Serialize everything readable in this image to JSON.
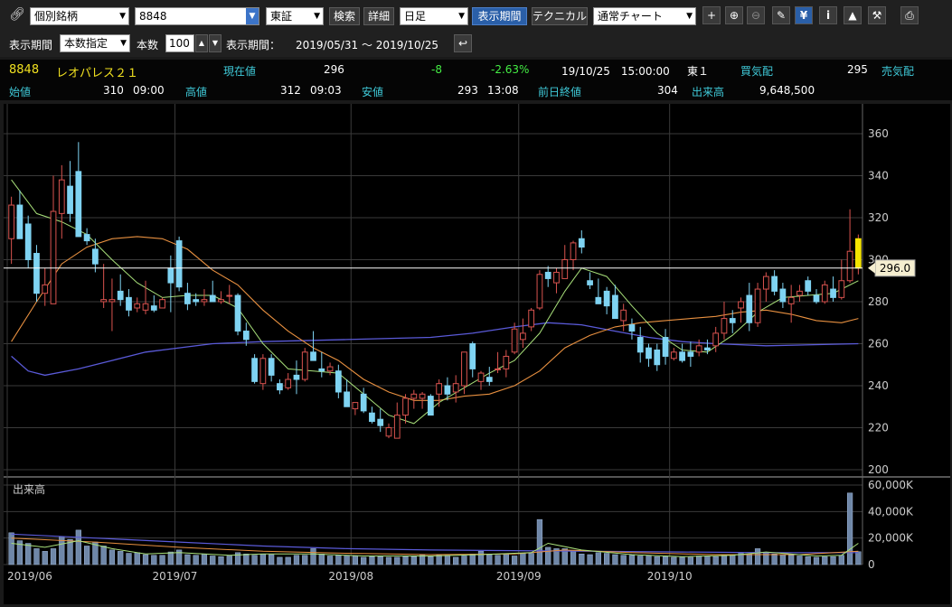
{
  "toolbar": {
    "mode_select": "個別銘柄",
    "code_input": "8848",
    "market_select": "東証",
    "search_label": "検索",
    "detail_label": "詳細",
    "period_select": "日足",
    "display_period_label": "表示期間",
    "technical_label": "テクニカル",
    "chart_type_select": "通常チャート"
  },
  "range_bar": {
    "period_label": "表示期間",
    "period_mode": "本数指定",
    "count_label": "本数",
    "count_value": "100",
    "range_label": "表示期間：",
    "range_value": "2019/05/31 ～ 2019/10/25"
  },
  "quote": {
    "code": "8848",
    "name": "レオパレス２１",
    "current_label": "現在値",
    "current": "296",
    "change": "-8",
    "change_pct": "-2.63%",
    "datetime": "19/10/25　15:00:00",
    "market": "東１",
    "bid_label": "買気配",
    "bid": "295",
    "ask_label": "売気配",
    "open_label": "始値",
    "open": "310",
    "open_time": "09:00",
    "high_label": "高値",
    "high": "312",
    "high_time": "09:03",
    "low_label": "安値",
    "low": "293",
    "low_time": "13:08",
    "prev_label": "前日終値",
    "prev": "304",
    "volume_label": "出来高",
    "volume": "9,648,500"
  },
  "colors": {
    "up": "#d9534f",
    "down": "#7fd3f2",
    "ma_short": "#a8e07a",
    "ma_mid": "#e89040",
    "ma_long": "#5a5ad8",
    "price_line": "#ffffff",
    "latest_candle": "#f5e400"
  },
  "chart_data": {
    "type": "candlestick",
    "price_ticks": [
      "360",
      "340",
      "320",
      "300",
      "280",
      "260",
      "240",
      "220",
      "200"
    ],
    "ylim": [
      200,
      360
    ],
    "current_price_label": "296.0",
    "volume_label": "出来高",
    "volume_ticks": [
      "60,000K",
      "40,000K",
      "20,000K",
      "0"
    ],
    "volume_ylim": [
      0,
      60000
    ],
    "x_labels": [
      "2019/06",
      "2019/07",
      "2019/08",
      "2019/09",
      "2019/10"
    ],
    "x_label_index": [
      0,
      20,
      41,
      61,
      79
    ],
    "candles": [
      {
        "o": 310,
        "h": 330,
        "l": 298,
        "c": 326
      },
      {
        "o": 326,
        "h": 333,
        "l": 313,
        "c": 310
      },
      {
        "o": 317,
        "h": 321,
        "l": 296,
        "c": 300
      },
      {
        "o": 303,
        "h": 307,
        "l": 280,
        "c": 284
      },
      {
        "o": 284,
        "h": 296,
        "l": 278,
        "c": 288
      },
      {
        "o": 279,
        "h": 340,
        "l": 279,
        "c": 323
      },
      {
        "o": 322,
        "h": 345,
        "l": 310,
        "c": 338
      },
      {
        "o": 335,
        "h": 347,
        "l": 318,
        "c": 322
      },
      {
        "o": 342,
        "h": 356,
        "l": 312,
        "c": 311
      },
      {
        "o": 312,
        "h": 315,
        "l": 307,
        "c": 309
      },
      {
        "o": 305,
        "h": 310,
        "l": 294,
        "c": 298
      },
      {
        "o": 280,
        "h": 298,
        "l": 277,
        "c": 281
      },
      {
        "o": 280,
        "h": 291,
        "l": 266,
        "c": 281
      },
      {
        "o": 285,
        "h": 293,
        "l": 278,
        "c": 281
      },
      {
        "o": 282,
        "h": 286,
        "l": 273,
        "c": 276
      },
      {
        "o": 277,
        "h": 282,
        "l": 275,
        "c": 279
      },
      {
        "o": 276,
        "h": 290,
        "l": 274,
        "c": 279
      },
      {
        "o": 278,
        "h": 283,
        "l": 275,
        "c": 276
      },
      {
        "o": 277,
        "h": 282,
        "l": 277,
        "c": 281
      },
      {
        "o": 296,
        "h": 302,
        "l": 275,
        "c": 289
      },
      {
        "o": 309,
        "h": 311,
        "l": 285,
        "c": 287
      },
      {
        "o": 284,
        "h": 289,
        "l": 276,
        "c": 279
      },
      {
        "o": 281,
        "h": 284,
        "l": 278,
        "c": 280
      },
      {
        "o": 280,
        "h": 286,
        "l": 278,
        "c": 281
      },
      {
        "o": 283,
        "h": 290,
        "l": 280,
        "c": 280
      },
      {
        "o": 280,
        "h": 285,
        "l": 279,
        "c": 281
      },
      {
        "o": 283,
        "h": 288,
        "l": 279,
        "c": 283
      },
      {
        "o": 283,
        "h": 284,
        "l": 264,
        "c": 266
      },
      {
        "o": 266,
        "h": 270,
        "l": 259,
        "c": 262
      },
      {
        "o": 253,
        "h": 255,
        "l": 241,
        "c": 242
      },
      {
        "o": 241,
        "h": 255,
        "l": 238,
        "c": 253
      },
      {
        "o": 253,
        "h": 255,
        "l": 242,
        "c": 245
      },
      {
        "o": 241,
        "h": 243,
        "l": 236,
        "c": 238
      },
      {
        "o": 239,
        "h": 246,
        "l": 238,
        "c": 243
      },
      {
        "o": 245,
        "h": 252,
        "l": 236,
        "c": 243
      },
      {
        "o": 243,
        "h": 258,
        "l": 242,
        "c": 256
      },
      {
        "o": 256,
        "h": 266,
        "l": 253,
        "c": 252
      },
      {
        "o": 248,
        "h": 256,
        "l": 244,
        "c": 247
      },
      {
        "o": 247,
        "h": 251,
        "l": 245,
        "c": 249
      },
      {
        "o": 247,
        "h": 250,
        "l": 234,
        "c": 237
      },
      {
        "o": 237,
        "h": 243,
        "l": 232,
        "c": 230
      },
      {
        "o": 229,
        "h": 232,
        "l": 226,
        "c": 232
      },
      {
        "o": 236,
        "h": 239,
        "l": 227,
        "c": 228
      },
      {
        "o": 227,
        "h": 230,
        "l": 222,
        "c": 223
      },
      {
        "o": 224,
        "h": 229,
        "l": 218,
        "c": 221
      },
      {
        "o": 216,
        "h": 222,
        "l": 215,
        "c": 220
      },
      {
        "o": 215,
        "h": 232,
        "l": 215,
        "c": 226
      },
      {
        "o": 226,
        "h": 236,
        "l": 222,
        "c": 234
      },
      {
        "o": 234,
        "h": 238,
        "l": 229,
        "c": 236
      },
      {
        "o": 234,
        "h": 237,
        "l": 229,
        "c": 236
      },
      {
        "o": 235,
        "h": 236,
        "l": 227,
        "c": 226
      },
      {
        "o": 236,
        "h": 243,
        "l": 230,
        "c": 241
      },
      {
        "o": 240,
        "h": 244,
        "l": 233,
        "c": 236
      },
      {
        "o": 237,
        "h": 245,
        "l": 232,
        "c": 241
      },
      {
        "o": 240,
        "h": 256,
        "l": 236,
        "c": 256
      },
      {
        "o": 260,
        "h": 261,
        "l": 244,
        "c": 248
      },
      {
        "o": 242,
        "h": 247,
        "l": 238,
        "c": 246
      },
      {
        "o": 244,
        "h": 249,
        "l": 240,
        "c": 242
      },
      {
        "o": 248,
        "h": 256,
        "l": 246,
        "c": 248
      },
      {
        "o": 248,
        "h": 257,
        "l": 244,
        "c": 254
      },
      {
        "o": 256,
        "h": 270,
        "l": 255,
        "c": 267
      },
      {
        "o": 262,
        "h": 272,
        "l": 258,
        "c": 265
      },
      {
        "o": 268,
        "h": 277,
        "l": 266,
        "c": 276
      },
      {
        "o": 277,
        "h": 295,
        "l": 276,
        "c": 293
      },
      {
        "o": 294,
        "h": 297,
        "l": 287,
        "c": 291
      },
      {
        "o": 289,
        "h": 296,
        "l": 284,
        "c": 294
      },
      {
        "o": 291,
        "h": 307,
        "l": 291,
        "c": 300
      },
      {
        "o": 300,
        "h": 309,
        "l": 295,
        "c": 308
      },
      {
        "o": 310,
        "h": 314,
        "l": 303,
        "c": 306
      },
      {
        "o": 290,
        "h": 294,
        "l": 286,
        "c": 288
      },
      {
        "o": 282,
        "h": 291,
        "l": 279,
        "c": 279
      },
      {
        "o": 285,
        "h": 287,
        "l": 274,
        "c": 278
      },
      {
        "o": 283,
        "h": 288,
        "l": 274,
        "c": 272
      },
      {
        "o": 271,
        "h": 279,
        "l": 266,
        "c": 276
      },
      {
        "o": 269,
        "h": 272,
        "l": 262,
        "c": 266
      },
      {
        "o": 263,
        "h": 268,
        "l": 251,
        "c": 256
      },
      {
        "o": 258,
        "h": 260,
        "l": 249,
        "c": 253
      },
      {
        "o": 257,
        "h": 260,
        "l": 247,
        "c": 250
      },
      {
        "o": 263,
        "h": 267,
        "l": 250,
        "c": 254
      },
      {
        "o": 253,
        "h": 258,
        "l": 252,
        "c": 256
      },
      {
        "o": 256,
        "h": 260,
        "l": 251,
        "c": 252
      },
      {
        "o": 256,
        "h": 261,
        "l": 249,
        "c": 254
      },
      {
        "o": 256,
        "h": 262,
        "l": 254,
        "c": 259
      },
      {
        "o": 258,
        "h": 262,
        "l": 255,
        "c": 257
      },
      {
        "o": 259,
        "h": 268,
        "l": 256,
        "c": 265
      },
      {
        "o": 265,
        "h": 280,
        "l": 262,
        "c": 272
      },
      {
        "o": 272,
        "h": 276,
        "l": 265,
        "c": 270
      },
      {
        "o": 277,
        "h": 282,
        "l": 270,
        "c": 280
      },
      {
        "o": 283,
        "h": 289,
        "l": 266,
        "c": 270
      },
      {
        "o": 270,
        "h": 289,
        "l": 268,
        "c": 286
      },
      {
        "o": 286,
        "h": 294,
        "l": 280,
        "c": 292
      },
      {
        "o": 292,
        "h": 295,
        "l": 283,
        "c": 285
      },
      {
        "o": 286,
        "h": 289,
        "l": 277,
        "c": 280
      },
      {
        "o": 279,
        "h": 288,
        "l": 270,
        "c": 282
      },
      {
        "o": 283,
        "h": 288,
        "l": 280,
        "c": 285
      },
      {
        "o": 290,
        "h": 292,
        "l": 283,
        "c": 285
      },
      {
        "o": 283,
        "h": 286,
        "l": 279,
        "c": 280
      },
      {
        "o": 280,
        "h": 290,
        "l": 279,
        "c": 288
      },
      {
        "o": 286,
        "h": 292,
        "l": 280,
        "c": 282
      },
      {
        "o": 282,
        "h": 300,
        "l": 281,
        "c": 290
      },
      {
        "o": 290,
        "h": 324,
        "l": 289,
        "c": 304
      },
      {
        "o": 310,
        "h": 312,
        "l": 293,
        "c": 296
      }
    ],
    "volume": [
      24000,
      18000,
      16000,
      12000,
      10000,
      12000,
      21000,
      19000,
      26000,
      14000,
      17000,
      14000,
      11000,
      10000,
      8500,
      9000,
      7500,
      7000,
      7000,
      9500,
      11000,
      7500,
      7000,
      8000,
      6500,
      6000,
      6500,
      9000,
      8000,
      7000,
      8000,
      7500,
      5500,
      5500,
      7000,
      7000,
      12000,
      8000,
      6500,
      7000,
      7000,
      6500,
      5500,
      6000,
      6000,
      5500,
      5500,
      6000,
      6000,
      7000,
      6000,
      7000,
      7000,
      5500,
      6500,
      8000,
      10000,
      7500,
      7000,
      8000,
      6500,
      8500,
      8500,
      34000,
      13000,
      12000,
      12000,
      10000,
      8000,
      7500,
      9000,
      8500,
      7500,
      7000,
      7000,
      6500,
      6500,
      6000,
      6000,
      5500,
      5500,
      5500,
      6500,
      6500,
      6000,
      7000,
      7500,
      8500,
      8000,
      12000,
      9000,
      8000,
      7500,
      7000,
      6500,
      6000,
      5500,
      6000,
      6000,
      7000,
      54000,
      9700
    ],
    "ma_short": [
      [
        0,
        338
      ],
      [
        3,
        322
      ],
      [
        6,
        318
      ],
      [
        9,
        312
      ],
      [
        12,
        300
      ],
      [
        15,
        289
      ],
      [
        18,
        282
      ],
      [
        21,
        283
      ],
      [
        24,
        283
      ],
      [
        27,
        277
      ],
      [
        30,
        260
      ],
      [
        33,
        248
      ],
      [
        36,
        247
      ],
      [
        39,
        246
      ],
      [
        42,
        236
      ],
      [
        45,
        226
      ],
      [
        48,
        222
      ],
      [
        51,
        232
      ],
      [
        54,
        239
      ],
      [
        57,
        246
      ],
      [
        60,
        252
      ],
      [
        63,
        265
      ],
      [
        66,
        285
      ],
      [
        68,
        296
      ],
      [
        71,
        292
      ],
      [
        74,
        278
      ],
      [
        77,
        265
      ],
      [
        80,
        257
      ],
      [
        83,
        256
      ],
      [
        86,
        264
      ],
      [
        89,
        275
      ],
      [
        92,
        282
      ],
      [
        95,
        283
      ],
      [
        98,
        284
      ],
      [
        101,
        290
      ]
    ],
    "ma_mid": [
      [
        0,
        261
      ],
      [
        3,
        280
      ],
      [
        6,
        298
      ],
      [
        9,
        306
      ],
      [
        12,
        310
      ],
      [
        15,
        311
      ],
      [
        18,
        310
      ],
      [
        21,
        305
      ],
      [
        24,
        295
      ],
      [
        27,
        288
      ],
      [
        30,
        276
      ],
      [
        33,
        266
      ],
      [
        36,
        258
      ],
      [
        39,
        252
      ],
      [
        42,
        243
      ],
      [
        45,
        237
      ],
      [
        48,
        233
      ],
      [
        51,
        233
      ],
      [
        54,
        235
      ],
      [
        57,
        236
      ],
      [
        60,
        240
      ],
      [
        63,
        247
      ],
      [
        66,
        258
      ],
      [
        69,
        264
      ],
      [
        72,
        268
      ],
      [
        75,
        270
      ],
      [
        78,
        271
      ],
      [
        81,
        272
      ],
      [
        84,
        273
      ],
      [
        87,
        275
      ],
      [
        90,
        276
      ],
      [
        93,
        274
      ],
      [
        96,
        271
      ],
      [
        99,
        270
      ],
      [
        101,
        272
      ]
    ],
    "ma_long": [
      [
        0,
        254
      ],
      [
        2,
        247
      ],
      [
        4,
        245
      ],
      [
        8,
        248
      ],
      [
        12,
        252
      ],
      [
        16,
        256
      ],
      [
        20,
        258
      ],
      [
        24,
        260
      ],
      [
        30,
        261
      ],
      [
        40,
        262
      ],
      [
        50,
        263
      ],
      [
        55,
        265
      ],
      [
        60,
        268
      ],
      [
        64,
        270
      ],
      [
        68,
        269
      ],
      [
        72,
        266
      ],
      [
        76,
        263
      ],
      [
        80,
        261
      ],
      [
        84,
        260
      ],
      [
        90,
        259
      ],
      [
        101,
        260
      ]
    ],
    "vol_ma_short": [
      [
        0,
        16000
      ],
      [
        4,
        13000
      ],
      [
        8,
        18000
      ],
      [
        12,
        12000
      ],
      [
        16,
        8000
      ],
      [
        20,
        9000
      ],
      [
        26,
        7000
      ],
      [
        30,
        8000
      ],
      [
        36,
        8000
      ],
      [
        42,
        6500
      ],
      [
        50,
        6500
      ],
      [
        56,
        7500
      ],
      [
        62,
        9000
      ],
      [
        64,
        16000
      ],
      [
        68,
        11000
      ],
      [
        74,
        7500
      ],
      [
        80,
        6000
      ],
      [
        86,
        7000
      ],
      [
        90,
        9500
      ],
      [
        96,
        6500
      ],
      [
        99,
        7000
      ],
      [
        101,
        16000
      ]
    ],
    "vol_ma_mid": [
      [
        0,
        20000
      ],
      [
        10,
        17000
      ],
      [
        20,
        13000
      ],
      [
        30,
        10000
      ],
      [
        40,
        8500
      ],
      [
        50,
        7500
      ],
      [
        60,
        8000
      ],
      [
        66,
        11000
      ],
      [
        74,
        9000
      ],
      [
        84,
        7500
      ],
      [
        94,
        7500
      ],
      [
        101,
        10000
      ]
    ],
    "vol_ma_long": [
      [
        0,
        23000
      ],
      [
        10,
        20000
      ],
      [
        20,
        17000
      ],
      [
        30,
        14000
      ],
      [
        40,
        12000
      ],
      [
        50,
        11000
      ],
      [
        60,
        10500
      ],
      [
        70,
        10000
      ],
      [
        80,
        9500
      ],
      [
        90,
        9000
      ],
      [
        101,
        9000
      ]
    ]
  }
}
